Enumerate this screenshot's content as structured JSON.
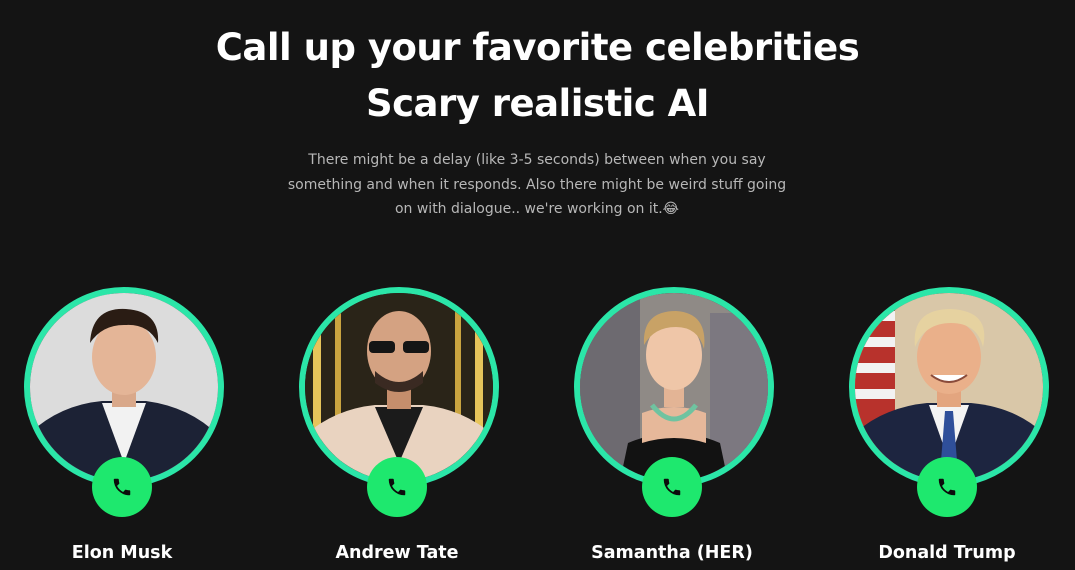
{
  "hero": {
    "title_line1": "Call up your favorite celebrities",
    "title_line2": "Scary realistic AI",
    "subtitle": "There might be a delay (like 3-5 seconds) between when you say something and when it responds. Also there might be weird stuff going on with dialogue.. we're working on it.😂"
  },
  "celebrities": [
    {
      "name": "Elon Musk",
      "icon": "phone-icon"
    },
    {
      "name": "Andrew Tate",
      "icon": "phone-icon"
    },
    {
      "name": "Samantha (HER)",
      "icon": "phone-icon"
    },
    {
      "name": "Donald Trump",
      "icon": "phone-icon"
    }
  ],
  "colors": {
    "background": "#141414",
    "ring": "#2be6a8",
    "call_button": "#1ee86e",
    "subtitle_text": "#b7b7b7"
  }
}
